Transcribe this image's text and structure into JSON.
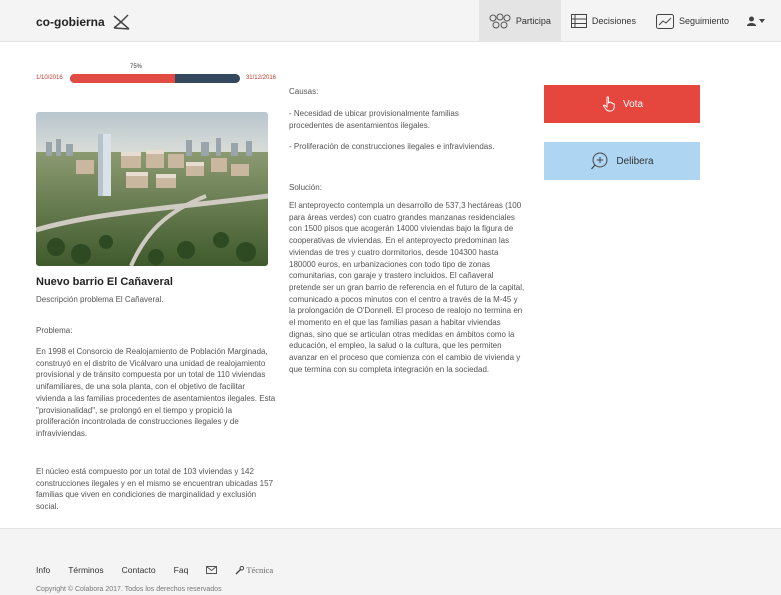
{
  "navbar": {
    "brand": "co-gobierna",
    "items": [
      {
        "label": "Participa",
        "icon": "circles-icon"
      },
      {
        "label": "Decisiones",
        "icon": "list-icon"
      },
      {
        "label": "Seguimiento",
        "icon": "chart-icon"
      }
    ],
    "user_icon": "user-icon"
  },
  "progress": {
    "percent_label": "75%",
    "percent": 0.62,
    "start_date": "1/10/2016",
    "end_date": "31/12/2016"
  },
  "project": {
    "title": "Nuevo barrio El Cañaveral",
    "description": "Descripción problema El Cañaveral."
  },
  "problem": {
    "label": "Problema:",
    "paragraphs": [
      "En 1998 el Consorcio de Realojamiento de Población Marginada, construyó en el distrito de Vicálvaro una unidad de realojamiento provisional y de tránsito compuesta por un total de 110 viviendas unifamiliares, de una sola planta, con el objetivo de facilitar vivienda a las familias procedentes de asentamientos ilegales. Esta \"provisionalidad\", se prolongó en el tiempo y propició la proliferación incontrolada de construcciones ilegales y de infraviviendas.",
      "El núcleo está compuesto por un total de 103 viviendas y 142 construcciones ilegales y en el mismo se encuentran ubicadas 157 familias que viven en condiciones de marginalidad y exclusión social."
    ]
  },
  "causes": {
    "label": "Causas:",
    "items": [
      "- Necesidad de ubicar provisionalmente familias procedentes de asentamientos ilegales.",
      "- Proliferación de construcciones ilegales e infraviviendas."
    ]
  },
  "solution": {
    "label": "Solución:",
    "text": "El anteproyecto contempla un desarrollo de 537,3 hectáreas (100 para áreas verdes) con cuatro grandes manzanas residenciales con 1500 pisos que acogerán 14000 viviendas bajo la figura de cooperativas de viviendas. En el anteproyecto predominan las viviendas de tres y cuatro dormitorios, desde 104300 hasta 180000 euros, en urbanizaciones con todo tipo de zonas comunitarias, con garaje y trastero incluidos. El cañaveral pretende ser un gran barrio de referencia en el futuro de la capital, comunicado a pocos minutos con el centro a través de la M-45 y la prolongación de O'Donnell. El proceso de realojo no termina en el momento en el que las familias pasan a habitar viviendas dignas, sino que se articulan otras medidas en ámbitos como la educación, el empleo, la salud o la cultura, que les permiten avanzar en el proceso que comienza con el cambio de vivienda y que termina con su completa integración en la sociedad."
  },
  "actions": {
    "vote_label": "Vota",
    "deliberate_label": "Delibera"
  },
  "footer": {
    "links": [
      "Info",
      "Términos",
      "Contacto",
      "Faq"
    ],
    "tecnica": "Técnica",
    "copyright": "Copyright © Colabora 2017. Todos los derechos reservados"
  },
  "colors": {
    "vote": "#e5473f",
    "deliberate": "#aed6f3",
    "progress_fill": "#e24a44",
    "progress_track": "#34495e"
  }
}
